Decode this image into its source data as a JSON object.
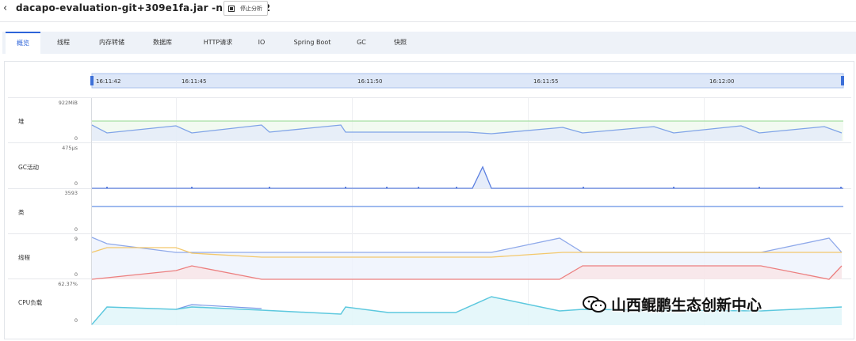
{
  "header": {
    "title": "dacapo-evaluation-git+309e1fa.jar -n 8507 h2",
    "stop_label": "停止分析"
  },
  "tabs": [
    {
      "label": "概览",
      "active": true
    },
    {
      "label": "线程",
      "active": false
    },
    {
      "label": "内存转储",
      "active": false
    },
    {
      "label": "数据库",
      "active": false
    },
    {
      "label": "HTTP请求",
      "active": false
    },
    {
      "label": "IO",
      "active": false
    },
    {
      "label": "Spring Boot",
      "active": false
    },
    {
      "label": "GC",
      "active": false
    },
    {
      "label": "快照",
      "active": false
    }
  ],
  "timeline": {
    "ticks": [
      "16:11:42",
      "16:11:45",
      "16:11:50",
      "16:11:55",
      "16:12:00"
    ]
  },
  "rows": [
    {
      "label": "堆",
      "max": "922MiB",
      "min": "0"
    },
    {
      "label": "GC活动",
      "max": "475μs",
      "min": "0"
    },
    {
      "label": "类",
      "max": "3593",
      "min": "0"
    },
    {
      "label": "线程",
      "max": "9",
      "min": "0"
    },
    {
      "label": "CPU负载",
      "max": "62.37%",
      "min": "0"
    }
  ],
  "colors": {
    "accent": "#2e64d9",
    "heap_used": "#7fa3e8",
    "heap_committed": "#a6dfa4",
    "gc": "#5b7fe0",
    "classes": "#7fa3e8",
    "threads_total": "#8fa9ea",
    "threads_a": "#f3c86b",
    "threads_b": "#ec7f7f",
    "cpu": "#5cc8de",
    "cpu_secondary": "#7a97e6"
  },
  "watermark": {
    "text": "山西鲲鹏生态创新中心"
  }
}
